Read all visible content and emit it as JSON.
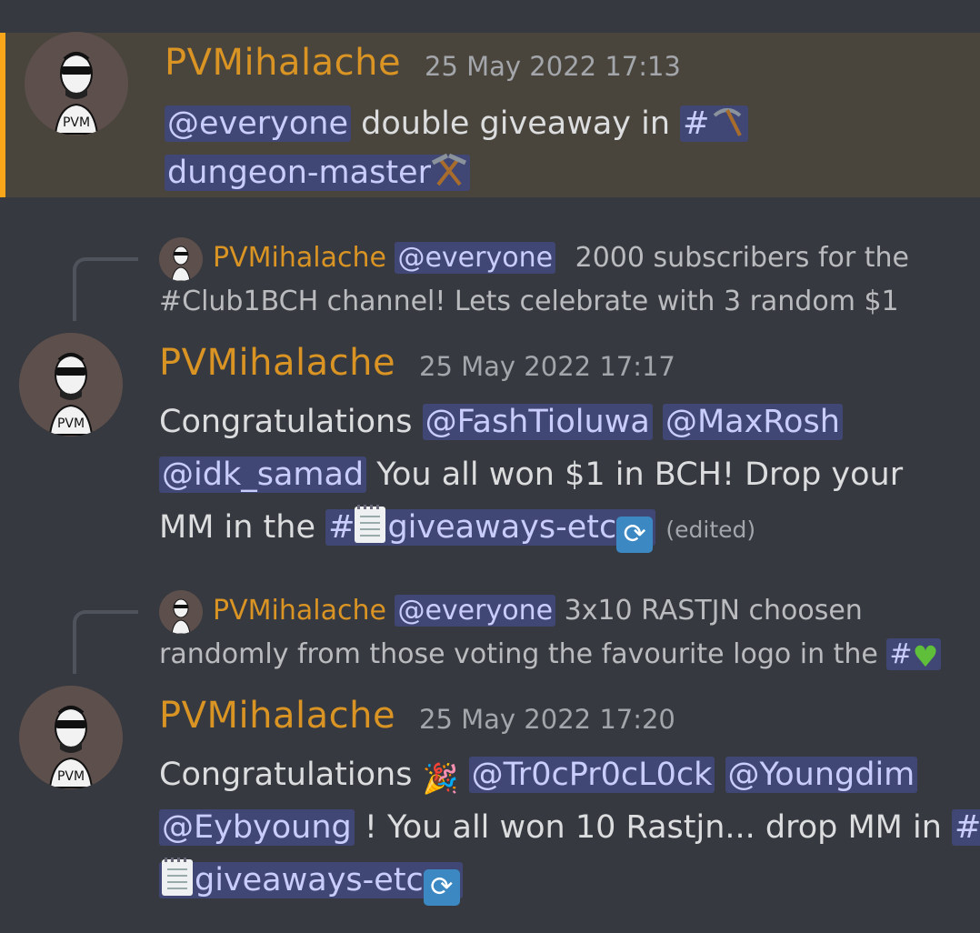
{
  "messages": [
    {
      "username": "PVMihalache",
      "timestamp": "25 May 2022 17:13",
      "line1_mention": "@everyone",
      "line1_text": " double giveaway in ",
      "line1_channel_hash": "#",
      "line2_channel": "dungeon-master",
      "highlighted": true
    },
    {
      "reply": {
        "username": "PVMihalache",
        "mention": "@everyone",
        "text1": "2000 subscribers for the",
        "text2": "#Club1BCH channel! Lets celebrate with 3 random $1"
      },
      "username": "PVMihalache",
      "timestamp": "25 May 2022 17:17",
      "line1_text": "Congratulations ",
      "mention1": "@FashTioluwa",
      "mention2": "@MaxRosh",
      "mention3": "@idk_samad",
      "line2_text": "  You all won $1 in BCH! Drop your",
      "line3_text": "MM in the ",
      "channel_hash": "#",
      "channel": "giveaways-etc",
      "edited": "(edited)"
    },
    {
      "reply": {
        "username": "PVMihalache",
        "mention": "@everyone",
        "text1": "3x10 RASTJN choosen",
        "text2": "randomly from those voting the favourite logo in the ",
        "channel_hash": "#"
      },
      "username": "PVMihalache",
      "timestamp": "25 May 2022 17:20",
      "line1_text": "Congratulations ",
      "mention1": "@Tr0cPr0cL0ck",
      "mention2": "@Youngdim",
      "mention3": "@Eybyoung",
      "line2_text": " ! You all won 10 Rastjn... drop MM in ",
      "channel_hash": "#",
      "channel": "giveaways-etc"
    }
  ],
  "colors": {
    "background": "#36393f",
    "highlight_bg": "#49443c",
    "highlight_bar": "#faa61a",
    "username": "#d99424",
    "mention_bg": "#414775",
    "mention_text": "#c9cdfb"
  },
  "icons": [
    "avatar-ape-icon",
    "pick-icon",
    "hammer-pick-icon",
    "memo-icon",
    "repeat-icon",
    "party-popper-icon",
    "green-heart-icon"
  ]
}
